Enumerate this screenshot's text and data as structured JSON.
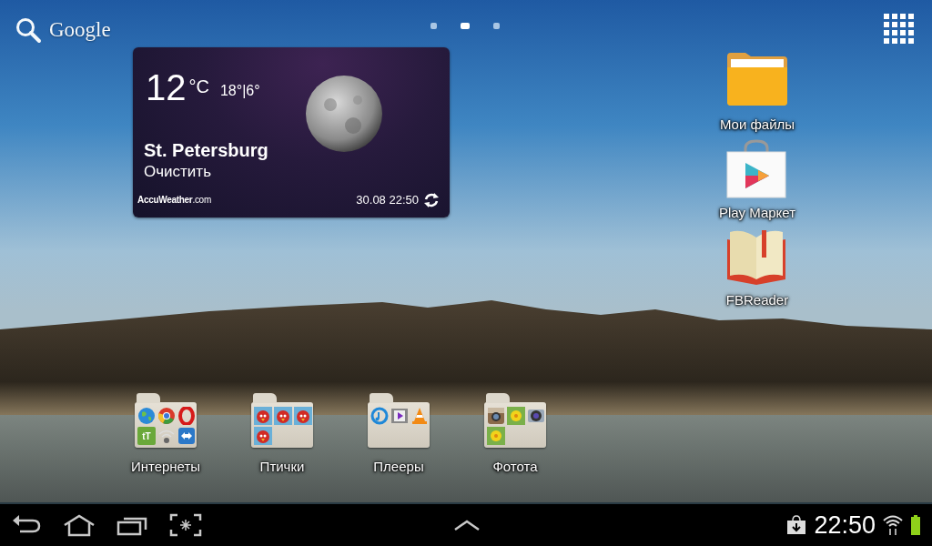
{
  "search": {
    "label": "Google"
  },
  "pages": [
    {
      "selected": false
    },
    {
      "selected": true
    },
    {
      "selected": false
    }
  ],
  "weather": {
    "temp": "12",
    "unit": "°C",
    "hilo": "18°|6°",
    "city": "St. Petersburg",
    "condition": "Очистить",
    "provider": "**AccuWeather**.com",
    "updated": "30.08 22:50"
  },
  "shortcuts": [
    {
      "label": "Мои файлы",
      "kind": "files"
    },
    {
      "label": "Play Маркет",
      "kind": "store"
    },
    {
      "label": "FBReader",
      "kind": "book"
    }
  ],
  "folders": [
    {
      "label": "Интернеты",
      "apps": [
        {
          "kind": "globe"
        },
        {
          "kind": "browser"
        },
        {
          "kind": "ring"
        },
        {
          "kind": "tile",
          "glyph": "tT"
        },
        {
          "kind": "wifi"
        },
        {
          "kind": "remote"
        }
      ]
    },
    {
      "label": "Птички",
      "apps": [
        {
          "kind": "bird"
        },
        {
          "kind": "bird"
        },
        {
          "kind": "bird"
        },
        {
          "kind": "bird"
        }
      ]
    },
    {
      "label": "Плееры",
      "apps": [
        {
          "kind": "music"
        },
        {
          "kind": "video"
        },
        {
          "kind": "cone"
        }
      ]
    },
    {
      "label": "Фотота",
      "apps": [
        {
          "kind": "camera"
        },
        {
          "kind": "flower"
        },
        {
          "kind": "lens"
        },
        {
          "kind": "flower"
        }
      ]
    }
  ],
  "status_bar": {
    "time": "22:50"
  }
}
